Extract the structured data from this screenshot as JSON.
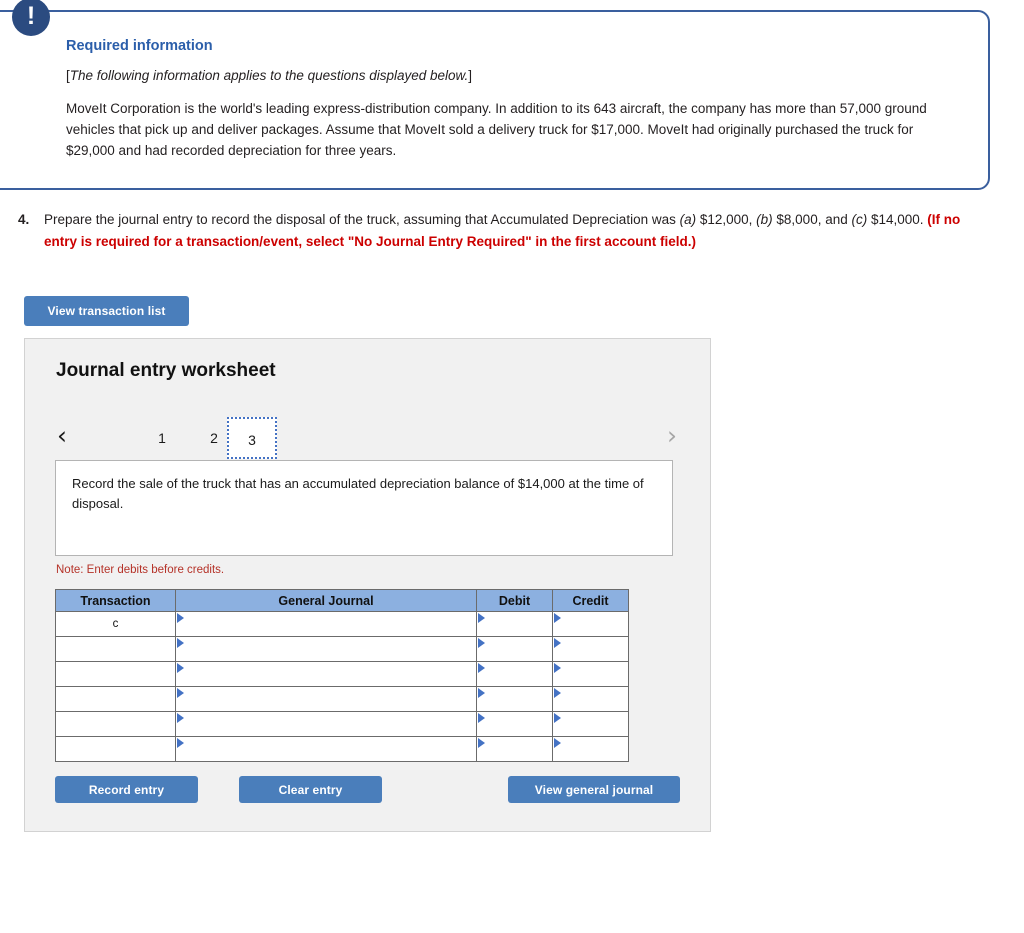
{
  "required_info": {
    "badge_icon": "exclamation-icon",
    "title": "Required information",
    "bracket_prefix": "[",
    "bracket_italic": "The following information applies to the questions displayed below.",
    "bracket_suffix": "]",
    "body": "MoveIt Corporation is the world's leading express-distribution company. In addition to its 643 aircraft, the company has more than 57,000 ground vehicles that pick up and deliver packages. Assume that MoveIt sold a delivery truck for $17,000. MoveIt had originally purchased the truck for $29,000 and had recorded depreciation for three years.",
    "border_color": "#3a5f9e",
    "badge_color": "#2b4b80",
    "title_color": "#2b5eaa"
  },
  "question": {
    "number": "4.",
    "part1": "Prepare the journal entry to record the disposal of the truck, assuming that Accumulated Depreciation was ",
    "italic_a": "(a)",
    "amount_a": " $12,000, ",
    "italic_b": "(b)",
    "amount_b": " $8,000, and ",
    "italic_c": "(c)",
    "amount_c": " $14,000. ",
    "red_note": "(If no entry is required for a transaction/event, select \"No Journal Entry Required\" in the first account field.)",
    "red_color": "#cc0000"
  },
  "toolbar": {
    "view_transaction_list": "View transaction list"
  },
  "worksheet": {
    "title": "Journal entry worksheet",
    "pager": {
      "prev_icon": "chevron-left-icon",
      "next_icon": "chevron-right-icon",
      "pages": [
        "1",
        "2",
        "3"
      ],
      "active_page": "3"
    },
    "description": "Record the sale of the truck that has an accumulated depreciation balance of $14,000 at the time of disposal.",
    "note": "Note: Enter debits before credits.",
    "note_color": "#b53228",
    "table": {
      "headers": [
        "Transaction",
        "General Journal",
        "Debit",
        "Credit"
      ],
      "header_bg": "#8cb0e0",
      "rows": [
        {
          "transaction": "c",
          "general_journal": "",
          "debit": "",
          "credit": ""
        },
        {
          "transaction": "",
          "general_journal": "",
          "debit": "",
          "credit": ""
        },
        {
          "transaction": "",
          "general_journal": "",
          "debit": "",
          "credit": ""
        },
        {
          "transaction": "",
          "general_journal": "",
          "debit": "",
          "credit": ""
        },
        {
          "transaction": "",
          "general_journal": "",
          "debit": "",
          "credit": ""
        },
        {
          "transaction": "",
          "general_journal": "",
          "debit": "",
          "credit": ""
        }
      ]
    },
    "buttons": {
      "record_entry": "Record entry",
      "clear_entry": "Clear entry",
      "view_general_journal": "View general journal",
      "color": "#4a7ebb"
    }
  }
}
